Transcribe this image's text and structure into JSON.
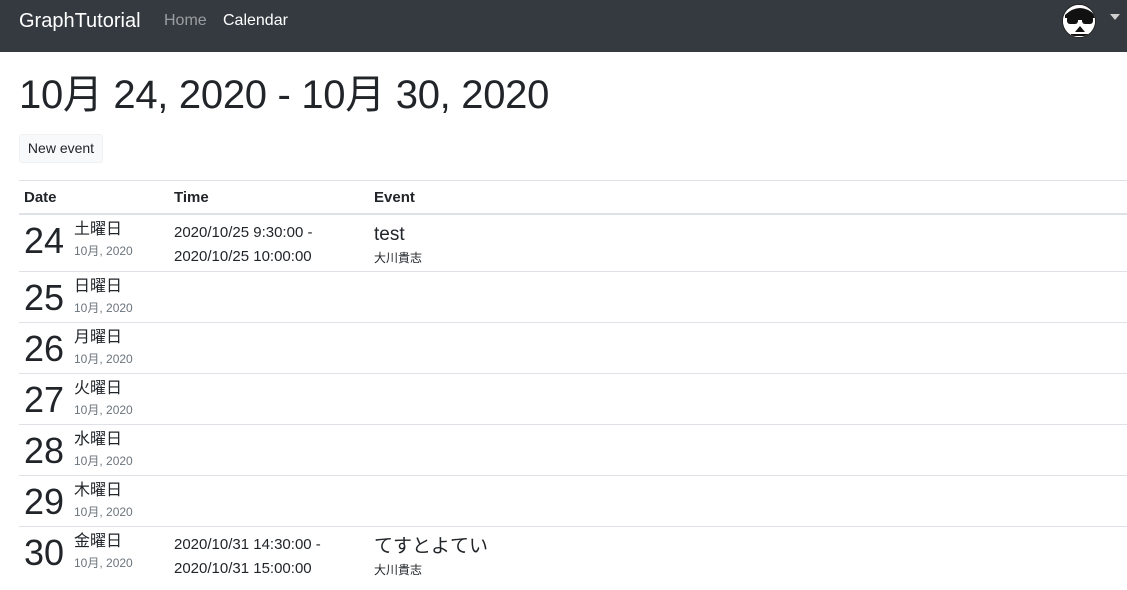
{
  "navbar": {
    "brand": "GraphTutorial",
    "links": [
      {
        "label": "Home",
        "active": false
      },
      {
        "label": "Calendar",
        "active": true
      }
    ],
    "avatar_icon": "user-avatar-icon",
    "dropdown_icon": "caret-down-icon"
  },
  "page": {
    "title": "10月 24, 2020 - 10月 30, 2020",
    "new_event_label": "New event"
  },
  "table": {
    "headers": {
      "date": "Date",
      "time": "Time",
      "event": "Event"
    },
    "rows": [
      {
        "day": "24",
        "weekday": "土曜日",
        "month_year": "10月, 2020",
        "time_start": "2020/10/25 9:30:00 -",
        "time_end": "2020/10/25 10:00:00",
        "subject": "test",
        "organizer": "大川貴志"
      },
      {
        "day": "25",
        "weekday": "日曜日",
        "month_year": "10月, 2020"
      },
      {
        "day": "26",
        "weekday": "月曜日",
        "month_year": "10月, 2020"
      },
      {
        "day": "27",
        "weekday": "火曜日",
        "month_year": "10月, 2020"
      },
      {
        "day": "28",
        "weekday": "水曜日",
        "month_year": "10月, 2020"
      },
      {
        "day": "29",
        "weekday": "木曜日",
        "month_year": "10月, 2020"
      },
      {
        "day": "30",
        "weekday": "金曜日",
        "month_year": "10月, 2020",
        "time_start": "2020/10/31 14:30:00 -",
        "time_end": "2020/10/31 15:00:00",
        "subject": "てすとよてい",
        "organizer": "大川貴志"
      }
    ]
  },
  "colors": {
    "navbar_bg": "#343a40",
    "nav_muted": "rgba(255,255,255,0.5)",
    "border": "#dee2e6",
    "muted_text": "#6c757d"
  }
}
